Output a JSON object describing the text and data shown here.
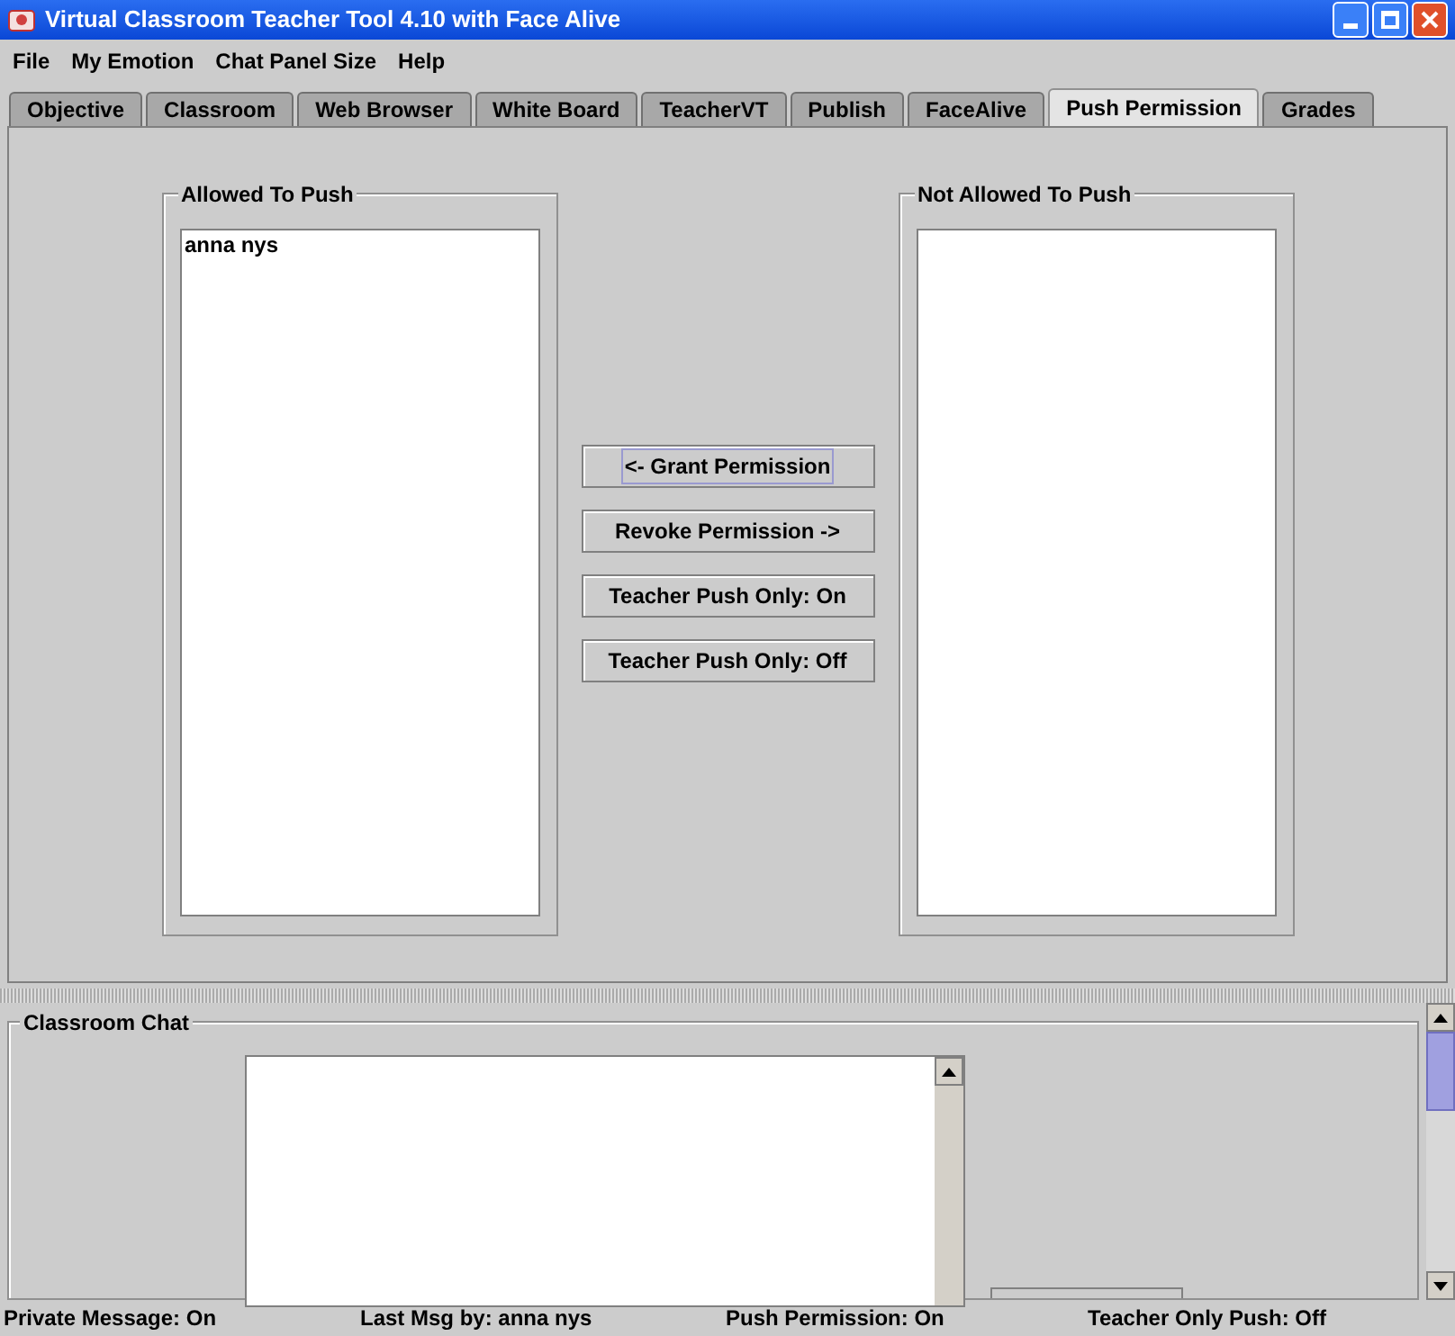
{
  "window": {
    "title": "Virtual Classroom Teacher Tool 4.10 with Face Alive"
  },
  "menu": [
    "File",
    "My Emotion",
    "Chat Panel Size",
    "Help"
  ],
  "tabs": [
    {
      "label": "Objective",
      "selected": false
    },
    {
      "label": "Classroom",
      "selected": false
    },
    {
      "label": "Web Browser",
      "selected": false
    },
    {
      "label": "White Board",
      "selected": false
    },
    {
      "label": "TeacherVT",
      "selected": false
    },
    {
      "label": "Publish",
      "selected": false
    },
    {
      "label": "FaceAlive",
      "selected": false
    },
    {
      "label": "Push Permission",
      "selected": true
    },
    {
      "label": "Grades",
      "selected": false
    }
  ],
  "allowed": {
    "title": "Allowed To Push",
    "items": [
      "anna nys"
    ]
  },
  "not_allowed": {
    "title": "Not Allowed To Push"
  },
  "buttons": [
    {
      "label": "<- Grant Permission",
      "focused": true
    },
    {
      "label": "Revoke Permission ->",
      "focused": false
    },
    {
      "label": "Teacher Push Only: On",
      "focused": false
    },
    {
      "label": "Teacher Push Only: Off",
      "focused": false
    }
  ],
  "chat": {
    "title": "Classroom Chat"
  },
  "status_bar": [
    "Private Message: On",
    "Last Msg by: anna nys",
    "Push Permission: On",
    "Teacher Only Push: Off"
  ]
}
